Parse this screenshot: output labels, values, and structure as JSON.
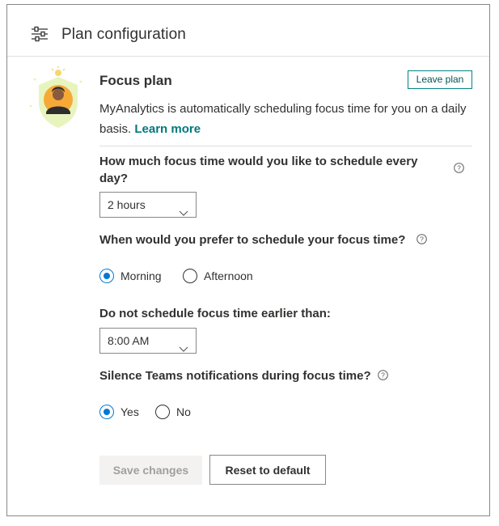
{
  "header": {
    "title": "Plan configuration",
    "icon": "sliders-icon"
  },
  "plan": {
    "title": "Focus plan",
    "leave_label": "Leave plan",
    "description": "MyAnalytics is automatically scheduling focus time for you on a daily basis.",
    "learn_more": "Learn more"
  },
  "questions": {
    "duration": {
      "label_line1": "How much focus time would you like to schedule every",
      "label_line2": "day?",
      "selected": "2 hours"
    },
    "time_of_day": {
      "label": "When would you prefer to schedule your focus time?",
      "options": [
        "Morning",
        "Afternoon"
      ],
      "selected": "Morning"
    },
    "earliest": {
      "label": "Do not schedule focus time earlier than:",
      "selected": "8:00 AM"
    },
    "silence": {
      "label": "Silence Teams notifications during focus time?",
      "options": [
        "Yes",
        "No"
      ],
      "selected": "Yes"
    }
  },
  "actions": {
    "save_label": "Save changes",
    "reset_label": "Reset to default"
  },
  "colors": {
    "accent": "#0078d4",
    "link": "#03787c",
    "leave_border": "#038387"
  }
}
